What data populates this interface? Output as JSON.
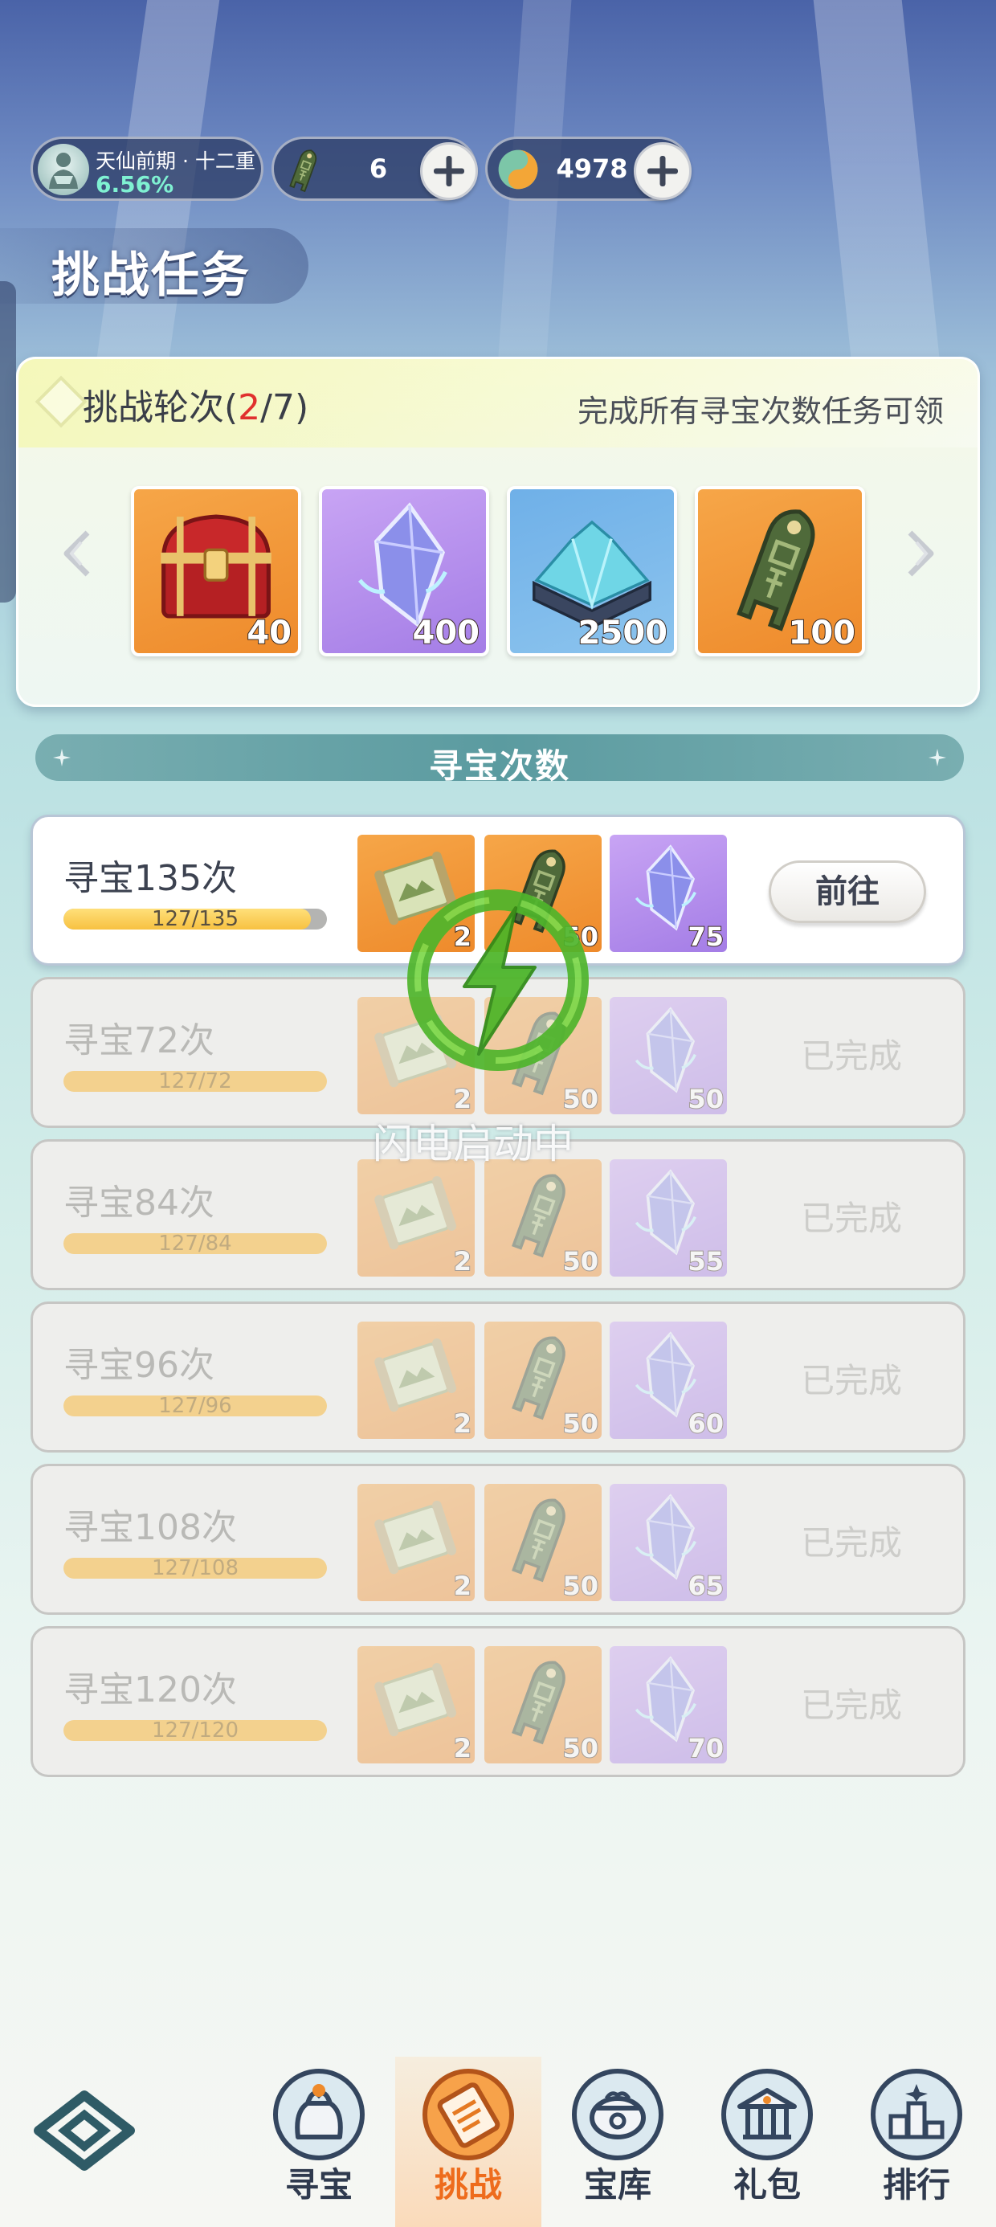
{
  "status": {
    "rank_name": "天仙前期 · 十二重",
    "rank_progress": "6.56%",
    "token_count": "6",
    "coin_count": "4978"
  },
  "page_title": "挑战任务",
  "rounds": {
    "label_prefix": "挑战轮次(",
    "current": "2",
    "separator_total": "/7)",
    "hint": "完成所有寻宝次数任务可领",
    "rewards": [
      {
        "icon": "treasure-chest",
        "qty": "40"
      },
      {
        "icon": "purple-crystal",
        "qty": "400"
      },
      {
        "icon": "crystal-ore-box",
        "qty": "2500"
      },
      {
        "icon": "jade-token",
        "qty": "100"
      }
    ]
  },
  "section_title": "寻宝次数",
  "tasks": [
    {
      "name": "寻宝135次",
      "progress_text": "127/135",
      "progress": 0.94,
      "rewards": [
        "2",
        "50",
        "75"
      ],
      "action": "前往",
      "state": "active"
    },
    {
      "name": "寻宝72次",
      "progress_text": "127/72",
      "progress": 1.0,
      "rewards": [
        "2",
        "50",
        "50"
      ],
      "action": "已完成",
      "state": "done"
    },
    {
      "name": "寻宝84次",
      "progress_text": "127/84",
      "progress": 1.0,
      "rewards": [
        "2",
        "50",
        "55"
      ],
      "action": "已完成",
      "state": "done"
    },
    {
      "name": "寻宝96次",
      "progress_text": "127/96",
      "progress": 1.0,
      "rewards": [
        "2",
        "50",
        "60"
      ],
      "action": "已完成",
      "state": "done"
    },
    {
      "name": "寻宝108次",
      "progress_text": "127/108",
      "progress": 1.0,
      "rewards": [
        "2",
        "50",
        "65"
      ],
      "action": "已完成",
      "state": "done"
    },
    {
      "name": "寻宝120次",
      "progress_text": "127/120",
      "progress": 1.0,
      "rewards": [
        "2",
        "50",
        "70"
      ],
      "action": "已完成",
      "state": "done"
    }
  ],
  "overlay_text": "闪电启动中",
  "nav": [
    {
      "label": "寻宝",
      "icon": "bag-icon"
    },
    {
      "label": "挑战",
      "icon": "scroll-icon"
    },
    {
      "label": "宝库",
      "icon": "cauldron-icon"
    },
    {
      "label": "礼包",
      "icon": "gift-temple-icon"
    },
    {
      "label": "排行",
      "icon": "ranking-icon"
    }
  ],
  "nav_active": "挑战",
  "colors": {
    "accent": "#ee6c1c",
    "highlight_red": "#e0302e",
    "teal": "#5b9ba0",
    "progress_yellow": "#f7c141"
  }
}
